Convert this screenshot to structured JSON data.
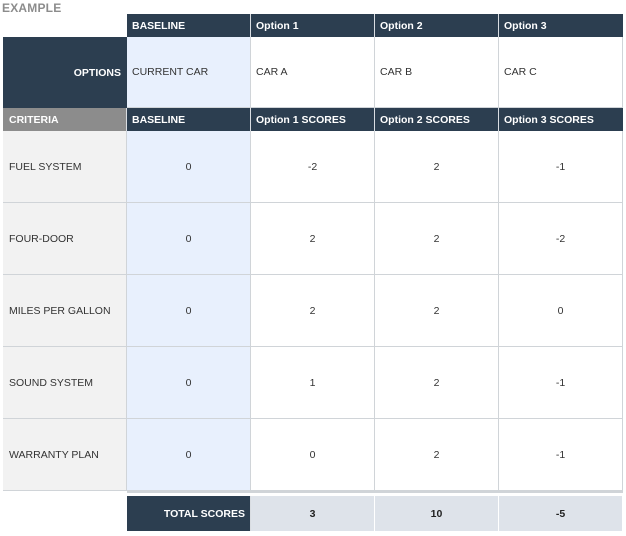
{
  "title": "EXAMPLE",
  "header": {
    "baseline": "BASELINE",
    "options": [
      "Option 1",
      "Option 2",
      "Option 3"
    ]
  },
  "options_row": {
    "label": "OPTIONS",
    "baseline": "CURRENT CAR",
    "values": [
      "CAR A",
      "CAR B",
      "CAR C"
    ]
  },
  "criteria_header": {
    "criteria": "CRITERIA",
    "baseline": "BASELINE",
    "scores": [
      "Option 1 SCORES",
      "Option 2 SCORES",
      "Option 3 SCORES"
    ]
  },
  "rows": [
    {
      "name": "FUEL SYSTEM",
      "baseline": "0",
      "scores": [
        "-2",
        "2",
        "-1"
      ]
    },
    {
      "name": "FOUR-DOOR",
      "baseline": "0",
      "scores": [
        "2",
        "2",
        "-2"
      ]
    },
    {
      "name": "MILES PER GALLON",
      "baseline": "0",
      "scores": [
        "2",
        "2",
        "0"
      ]
    },
    {
      "name": "SOUND SYSTEM",
      "baseline": "0",
      "scores": [
        "1",
        "2",
        "-1"
      ]
    },
    {
      "name": "WARRANTY PLAN",
      "baseline": "0",
      "scores": [
        "0",
        "2",
        "-1"
      ]
    }
  ],
  "totals": {
    "label": "TOTAL SCORES",
    "values": [
      "3",
      "10",
      "-5"
    ]
  }
}
